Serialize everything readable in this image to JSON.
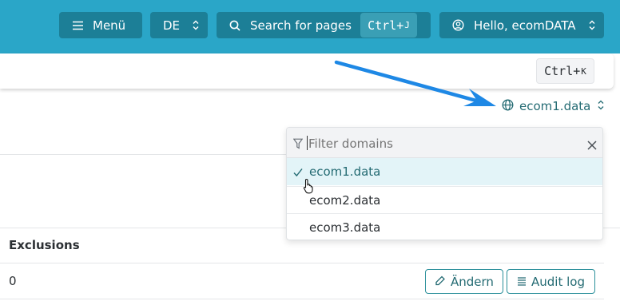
{
  "topbar": {
    "menu_label": "Menü",
    "lang_label": "DE",
    "search_label": "Search for pages",
    "search_shortcut_prefix": "Ctrl+",
    "search_shortcut_key": "J",
    "user_label": "Hello, ecomDATA"
  },
  "toolbar": {
    "shortcut_prefix": "Ctrl+",
    "shortcut_key": "K"
  },
  "domain_switch": {
    "current": "ecom1.data"
  },
  "dropdown": {
    "filter_placeholder": "Filter domains",
    "items": [
      {
        "label": "ecom1.data",
        "selected": true
      },
      {
        "label": "ecom2.data",
        "selected": false
      },
      {
        "label": "ecom3.data",
        "selected": false
      }
    ]
  },
  "table": {
    "column_header": "Exclusions",
    "row_value": "0",
    "edit_label": "Ändern",
    "audit_label": "Audit log"
  },
  "colors": {
    "topbar_bg": "#2aa6c8",
    "topbar_button": "#1c7f97",
    "accent_teal": "#246b73",
    "selected_row": "#e3f4f8",
    "arrow": "#1e88e5"
  }
}
